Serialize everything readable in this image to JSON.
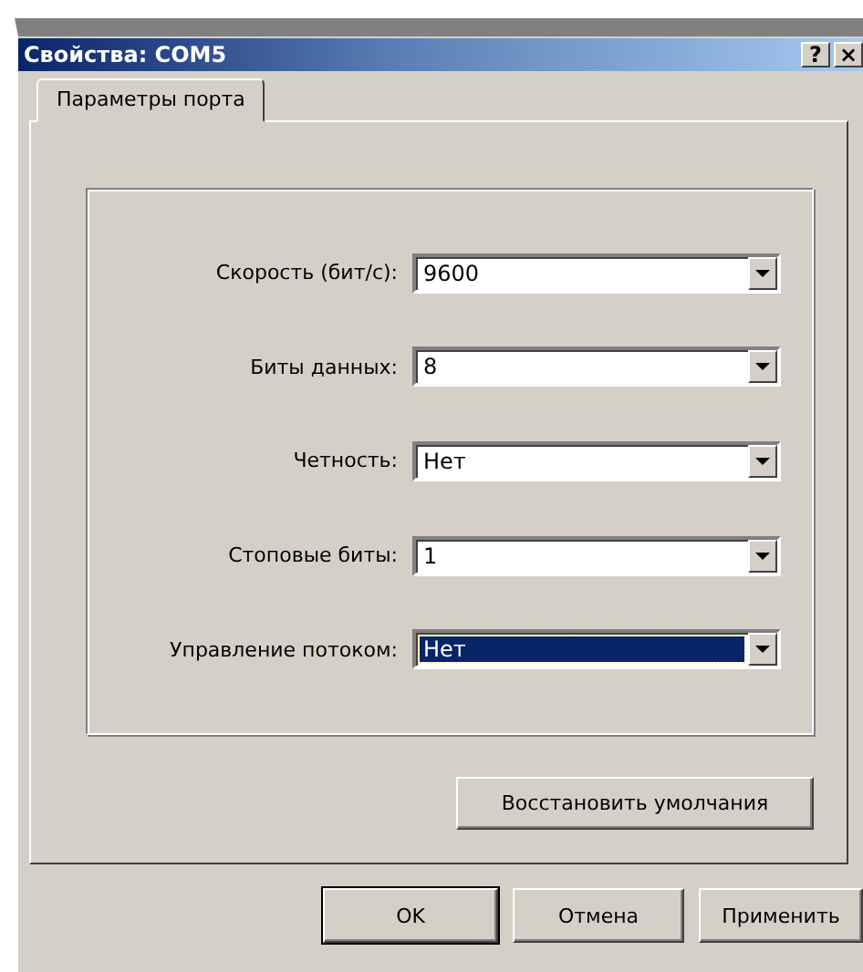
{
  "window": {
    "title": "Свойства: COM5",
    "title_buttons": [
      "?",
      "×"
    ]
  },
  "tabs": [
    {
      "label": "Параметры порта",
      "selected": true
    }
  ],
  "fields": [
    {
      "label": "Скорость (бит/с):",
      "value": "9600",
      "focused": false
    },
    {
      "label": "Биты данных:",
      "value": "8",
      "focused": false
    },
    {
      "label": "Четность:",
      "value": "Нет",
      "focused": false
    },
    {
      "label": "Стоповые биты:",
      "value": "1",
      "focused": false
    },
    {
      "label": "Управление потоком:",
      "value": "Нет",
      "focused": true
    }
  ],
  "restore_button": "Восстановить умолчания",
  "buttons": [
    {
      "label": "OK",
      "default": true
    },
    {
      "label": "Отмена",
      "default": false
    },
    {
      "label": "Применить",
      "default": false
    }
  ]
}
